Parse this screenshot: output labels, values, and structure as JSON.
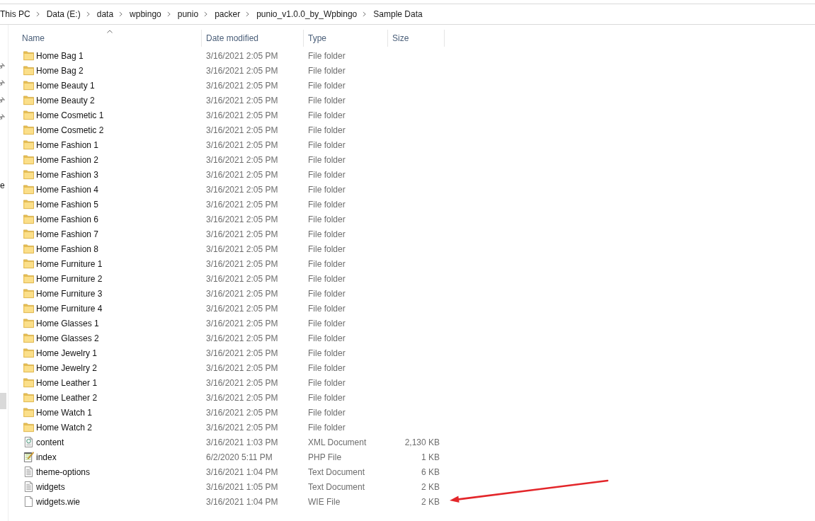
{
  "address_bar": {
    "crumbs": [
      "This PC",
      "Data (E:)",
      "data",
      "wpbingo",
      "punio",
      "packer",
      "punio_v1.0.0_by_Wpbingo",
      "Sample Data"
    ]
  },
  "sidebar": {
    "items": [
      {
        "kind": "pinned",
        "selected": false
      },
      {
        "kind": "pinned",
        "selected": false
      },
      {
        "kind": "pinned",
        "selected": false
      },
      {
        "kind": "pinned",
        "selected": false
      },
      {
        "kind": "text",
        "text": "e",
        "selected": false
      },
      {
        "kind": "plain",
        "selected": true
      }
    ]
  },
  "table": {
    "columns": [
      {
        "label": "Name",
        "sorted": true
      },
      {
        "label": "Date modified",
        "sorted": false
      },
      {
        "label": "Type",
        "sorted": false
      },
      {
        "label": "Size",
        "sorted": false
      }
    ],
    "rows": [
      {
        "kind": "folder",
        "name": "Home Bag 1",
        "date_modified": "3/16/2021 2:05 PM",
        "type": "File folder",
        "arrow": false
      },
      {
        "kind": "folder",
        "name": "Home Bag 2",
        "date_modified": "3/16/2021 2:05 PM",
        "type": "File folder",
        "arrow": false
      },
      {
        "kind": "folder",
        "name": "Home Beauty 1",
        "date_modified": "3/16/2021 2:05 PM",
        "type": "File folder",
        "arrow": false
      },
      {
        "kind": "folder",
        "name": "Home Beauty 2",
        "date_modified": "3/16/2021 2:05 PM",
        "type": "File folder",
        "arrow": false
      },
      {
        "kind": "folder",
        "name": "Home Cosmetic 1",
        "date_modified": "3/16/2021 2:05 PM",
        "type": "File folder",
        "arrow": false
      },
      {
        "kind": "folder",
        "name": "Home Cosmetic 2",
        "date_modified": "3/16/2021 2:05 PM",
        "type": "File folder",
        "arrow": false
      },
      {
        "kind": "folder",
        "name": "Home Fashion 1",
        "date_modified": "3/16/2021 2:05 PM",
        "type": "File folder",
        "arrow": false
      },
      {
        "kind": "folder",
        "name": "Home Fashion 2",
        "date_modified": "3/16/2021 2:05 PM",
        "type": "File folder",
        "arrow": false
      },
      {
        "kind": "folder",
        "name": "Home Fashion 3",
        "date_modified": "3/16/2021 2:05 PM",
        "type": "File folder",
        "arrow": false
      },
      {
        "kind": "folder",
        "name": "Home Fashion 4",
        "date_modified": "3/16/2021 2:05 PM",
        "type": "File folder",
        "arrow": false
      },
      {
        "kind": "folder",
        "name": "Home Fashion 5",
        "date_modified": "3/16/2021 2:05 PM",
        "type": "File folder",
        "arrow": false
      },
      {
        "kind": "folder",
        "name": "Home Fashion 6",
        "date_modified": "3/16/2021 2:05 PM",
        "type": "File folder",
        "arrow": false
      },
      {
        "kind": "folder",
        "name": "Home Fashion 7",
        "date_modified": "3/16/2021 2:05 PM",
        "type": "File folder",
        "arrow": false
      },
      {
        "kind": "folder",
        "name": "Home Fashion 8",
        "date_modified": "3/16/2021 2:05 PM",
        "type": "File folder",
        "arrow": false
      },
      {
        "kind": "folder",
        "name": "Home Furniture 1",
        "date_modified": "3/16/2021 2:05 PM",
        "type": "File folder",
        "arrow": false
      },
      {
        "kind": "folder",
        "name": "Home Furniture 2",
        "date_modified": "3/16/2021 2:05 PM",
        "type": "File folder",
        "arrow": false
      },
      {
        "kind": "folder",
        "name": "Home Furniture 3",
        "date_modified": "3/16/2021 2:05 PM",
        "type": "File folder",
        "arrow": false
      },
      {
        "kind": "folder",
        "name": "Home Furniture 4",
        "date_modified": "3/16/2021 2:05 PM",
        "type": "File folder",
        "arrow": false
      },
      {
        "kind": "folder",
        "name": "Home Glasses 1",
        "date_modified": "3/16/2021 2:05 PM",
        "type": "File folder",
        "arrow": false
      },
      {
        "kind": "folder",
        "name": "Home Glasses 2",
        "date_modified": "3/16/2021 2:05 PM",
        "type": "File folder",
        "arrow": false
      },
      {
        "kind": "folder",
        "name": "Home Jewelry 1",
        "date_modified": "3/16/2021 2:05 PM",
        "type": "File folder",
        "arrow": false
      },
      {
        "kind": "folder",
        "name": "Home Jewelry 2",
        "date_modified": "3/16/2021 2:05 PM",
        "type": "File folder",
        "arrow": false
      },
      {
        "kind": "folder",
        "name": "Home Leather 1",
        "date_modified": "3/16/2021 2:05 PM",
        "type": "File folder",
        "arrow": false
      },
      {
        "kind": "folder",
        "name": "Home Leather 2",
        "date_modified": "3/16/2021 2:05 PM",
        "type": "File folder",
        "arrow": false
      },
      {
        "kind": "folder",
        "name": "Home Watch 1",
        "date_modified": "3/16/2021 2:05 PM",
        "type": "File folder",
        "arrow": false
      },
      {
        "kind": "folder",
        "name": "Home Watch 2",
        "date_modified": "3/16/2021 2:05 PM",
        "type": "File folder",
        "arrow": false
      },
      {
        "kind": "xml",
        "name": "content",
        "date_modified": "3/16/2021 1:03 PM",
        "type": "XML Document",
        "size": "2,130 KB",
        "arrow": false
      },
      {
        "kind": "php",
        "name": "index",
        "date_modified": "6/2/2020 5:11 PM",
        "type": "PHP File",
        "size": "1 KB",
        "arrow": false
      },
      {
        "kind": "text",
        "name": "theme-options",
        "date_modified": "3/16/2021 1:04 PM",
        "type": "Text Document",
        "size": "6 KB",
        "arrow": false
      },
      {
        "kind": "text",
        "name": "widgets",
        "date_modified": "3/16/2021 1:05 PM",
        "type": "Text Document",
        "size": "2 KB",
        "arrow": false
      },
      {
        "kind": "file",
        "name": "widgets.wie",
        "date_modified": "3/16/2021 1:04 PM",
        "type": "WIE File",
        "size": "2 KB",
        "arrow": true
      }
    ]
  }
}
